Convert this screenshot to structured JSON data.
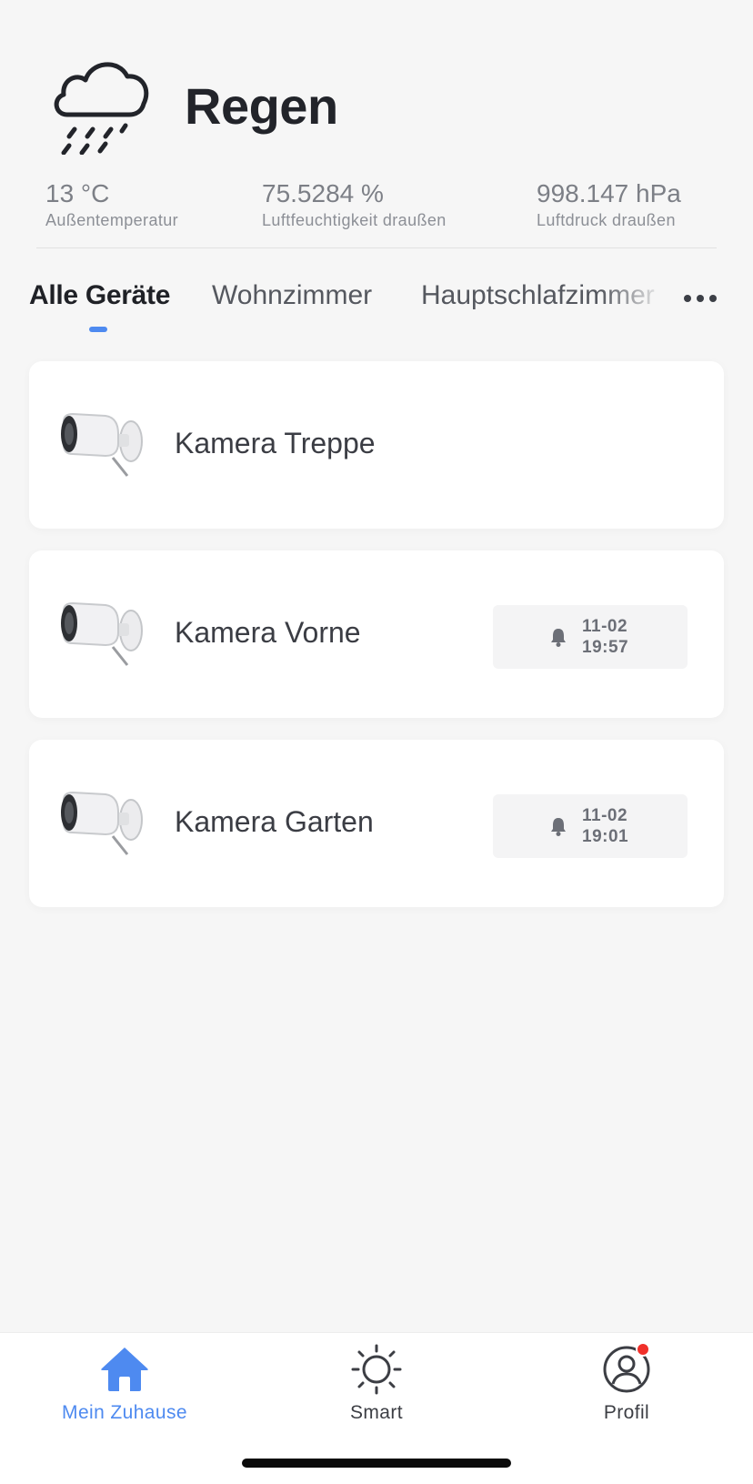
{
  "weather": {
    "condition": "Regen",
    "icon": "cloud-rain-icon",
    "stats": [
      {
        "value": "13 °C",
        "label": "Außentemperatur"
      },
      {
        "value": "75.5284 %",
        "label": "Luftfeuchtigkeit draußen"
      },
      {
        "value": "998.147 hPa",
        "label": "Luftdruck draußen"
      }
    ]
  },
  "tabs": [
    {
      "label": "Alle Geräte",
      "active": true
    },
    {
      "label": "Wohnzimmer",
      "active": false
    },
    {
      "label": "Hauptschlafzimmer",
      "active": false
    }
  ],
  "more_icon": "more-horizontal-icon",
  "devices": [
    {
      "name": "Kamera Treppe",
      "icon": "camera-icon"
    },
    {
      "name": "Kamera Vorne",
      "icon": "camera-icon",
      "alert": {
        "date": "11-02",
        "time": "19:57",
        "icon": "bell-icon"
      }
    },
    {
      "name": "Kamera Garten",
      "icon": "camera-icon",
      "alert": {
        "date": "11-02",
        "time": "19:01",
        "icon": "bell-icon"
      }
    }
  ],
  "nav": [
    {
      "label": "Mein Zuhause",
      "icon": "home-icon",
      "active": true
    },
    {
      "label": "Smart",
      "icon": "sun-icon",
      "active": false
    },
    {
      "label": "Profil",
      "icon": "profile-icon",
      "active": false,
      "badge": true
    }
  ],
  "colors": {
    "accent": "#4e8af0",
    "background": "#f6f6f6",
    "card": "#ffffff",
    "notification": "#f0302a"
  }
}
